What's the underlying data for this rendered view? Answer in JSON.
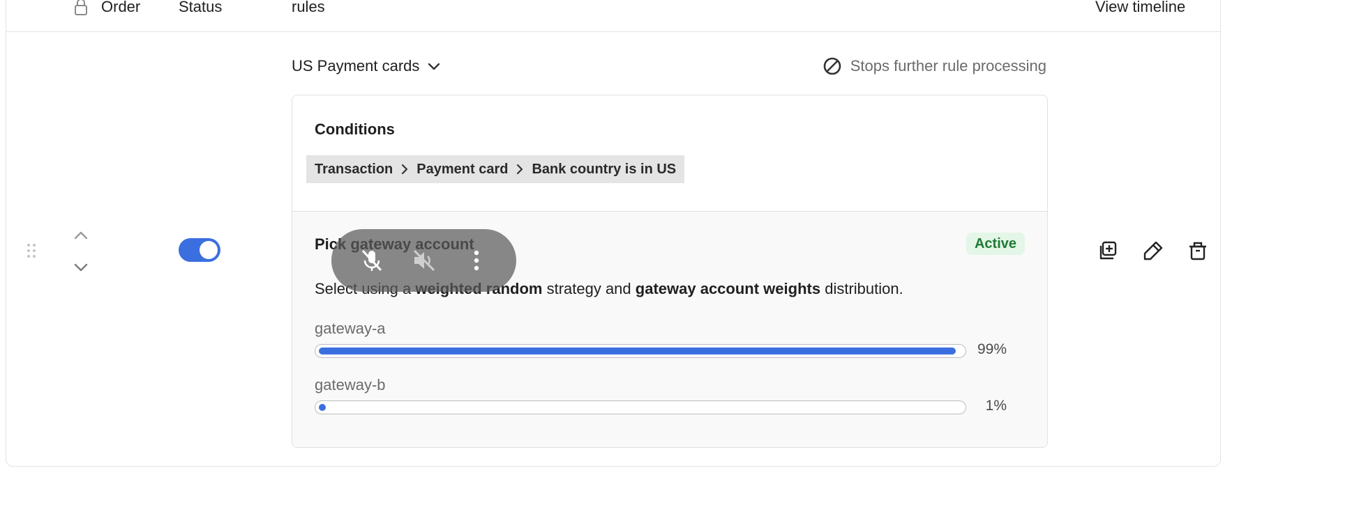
{
  "header": {
    "order": "Order",
    "status": "Status",
    "rules": "rules",
    "view_timeline": "View timeline"
  },
  "rule": {
    "name": "US Payment cards",
    "stops_label": "Stops further rule processing",
    "enabled": true,
    "conditions_title": "Conditions",
    "condition_path": [
      "Transaction",
      "Payment card",
      "Bank country is in US"
    ],
    "action": {
      "title": "Pick gateway account",
      "status": "Active",
      "desc_prefix": "Select using a",
      "desc_strategy": "weighted random",
      "desc_middle": "strategy and",
      "desc_dist": "gateway account weights",
      "desc_suffix": "distribution.",
      "gateways": [
        {
          "name": "gateway-a",
          "percent_label": "99%",
          "value": 0.99
        },
        {
          "name": "gateway-b",
          "percent_label": "1%",
          "value": 0.01
        }
      ]
    }
  },
  "colors": {
    "accent": "#3b6fe0",
    "active_badge_bg": "#e3f6e7",
    "active_badge_text": "#1f7a35"
  },
  "icons": {
    "row_actions": [
      "duplicate-icon",
      "edit-icon",
      "delete-icon"
    ],
    "overlay": [
      "mic-off-icon",
      "volume-off-icon",
      "more-vertical-icon"
    ]
  }
}
